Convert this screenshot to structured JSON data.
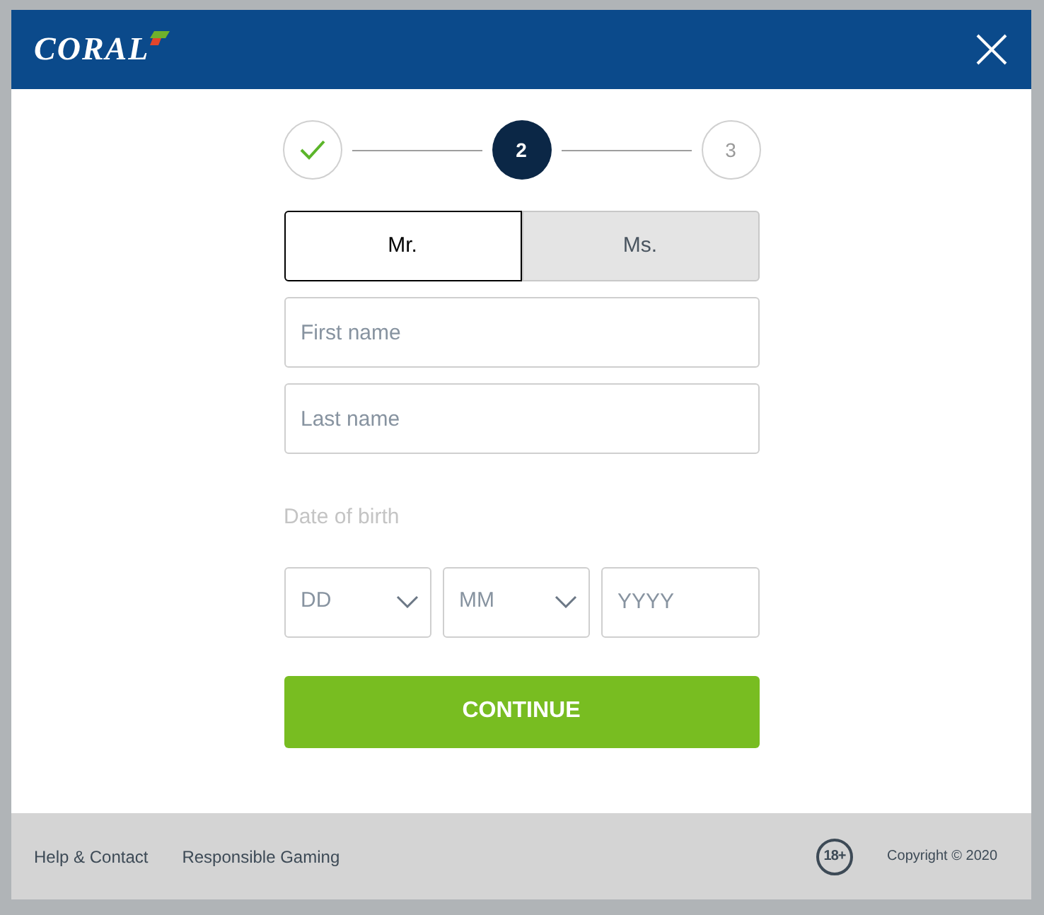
{
  "header": {
    "logo": "CORAL"
  },
  "steps": [
    {
      "kind": "done"
    },
    {
      "label": "2",
      "kind": "current"
    },
    {
      "label": "3",
      "kind": "upcoming"
    }
  ],
  "title_options": [
    {
      "label": "Mr.",
      "selected": true
    },
    {
      "label": "Ms.",
      "selected": false
    }
  ],
  "fields": [
    {
      "placeholder": "First name"
    },
    {
      "placeholder": "Last name"
    }
  ],
  "date_of_birth": {
    "label": "Date of birth",
    "parts": [
      {
        "kind": "select",
        "placeholder": "DD"
      },
      {
        "kind": "select",
        "placeholder": "MM"
      },
      {
        "kind": "input",
        "placeholder": "YYYY"
      }
    ]
  },
  "continue_button": "CONTINUE",
  "footer": {
    "links": [
      "Help & Contact",
      "Responsible Gaming"
    ],
    "age_badge": "18+",
    "copyright": "Copyright © 2020"
  }
}
